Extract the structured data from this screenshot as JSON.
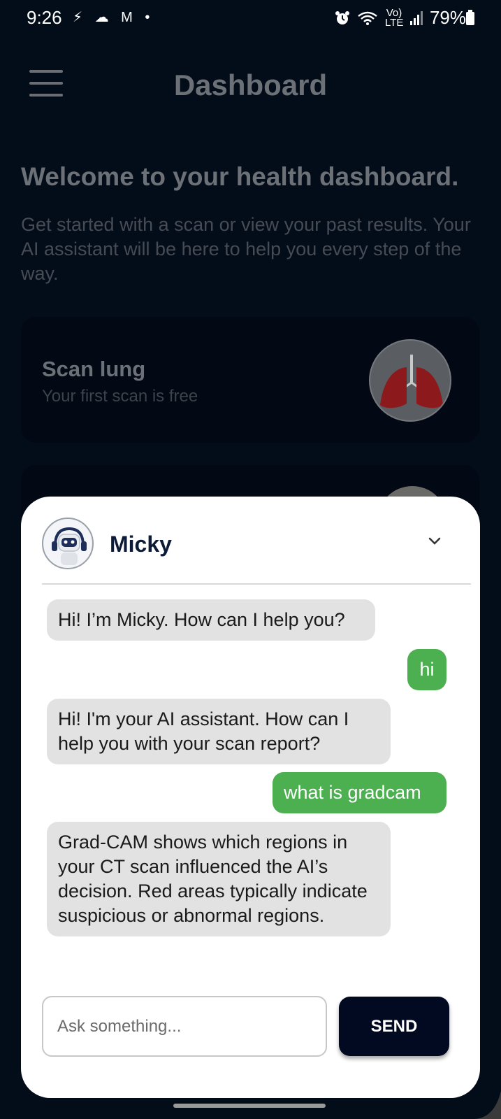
{
  "status_bar": {
    "time": "9:26",
    "left_icons": "⚡ ☁ M •",
    "network_label": "Vo) LTE",
    "battery": "79%"
  },
  "header": {
    "title": "Dashboard"
  },
  "welcome": {
    "heading": "Welcome to your health dashboard.",
    "subtext": "Get started with a scan or view your past results. Your AI assistant will be here to help you every step of the way."
  },
  "scan_card": {
    "title": "Scan lung",
    "subtitle": "Your first scan is free"
  },
  "chat": {
    "bot_name": "Micky",
    "messages": [
      {
        "sender": "bot",
        "text": "Hi! I’m Micky. How can I help you?"
      },
      {
        "sender": "user",
        "text": "hi"
      },
      {
        "sender": "bot",
        "text": "Hi! I'm your AI assistant. How can I help you with your scan report?"
      },
      {
        "sender": "user",
        "text": "what is gradcam"
      },
      {
        "sender": "bot",
        "text": "Grad-CAM shows which regions in your CT scan influenced the AI’s decision. Red areas typically indicate suspicious or abnormal regions."
      }
    ],
    "input_placeholder": "Ask something...",
    "send_label": "SEND"
  },
  "colors": {
    "background": "#030c19",
    "user_bubble": "#4caf50",
    "bot_bubble": "#e2e2e2",
    "send_button": "#020a22",
    "bot_name": "#0d1b36"
  }
}
